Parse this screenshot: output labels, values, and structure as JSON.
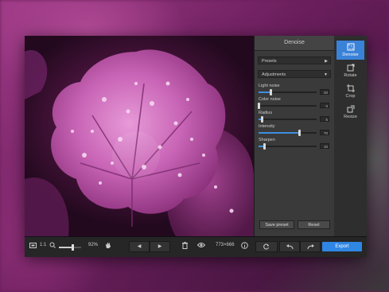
{
  "panel": {
    "title": "Denoise",
    "presets_label": "Presets",
    "adjustments_label": "Adjustments",
    "sliders": [
      {
        "label": "Light noise",
        "value": "20",
        "fraction": 0.2
      },
      {
        "label": "Color noise",
        "value": "0",
        "fraction": 0.0
      },
      {
        "label": "Radius",
        "value": "5",
        "fraction": 0.05
      },
      {
        "label": "Intensity",
        "value": "70",
        "fraction": 0.7
      },
      {
        "label": "Sharpen",
        "value": "10",
        "fraction": 0.1
      }
    ],
    "save_preset_label": "Save preset",
    "reset_label": "Reset"
  },
  "tools": [
    {
      "label": "Denoise",
      "icon": "denoise-icon",
      "active": true
    },
    {
      "label": "Rotate",
      "icon": "rotate-icon",
      "active": false
    },
    {
      "label": "Crop",
      "icon": "crop-icon",
      "active": false
    },
    {
      "label": "Resize",
      "icon": "resize-icon",
      "active": false
    }
  ],
  "bottom": {
    "actual_size_label": "1:1",
    "zoom_value": "92%",
    "zoom_fraction": 0.6,
    "dimensions": "773×666",
    "export_label": "Export"
  },
  "colors": {
    "accent": "#3a82d8",
    "export": "#2f86e3",
    "slider_fill": "#3e8ee0"
  }
}
